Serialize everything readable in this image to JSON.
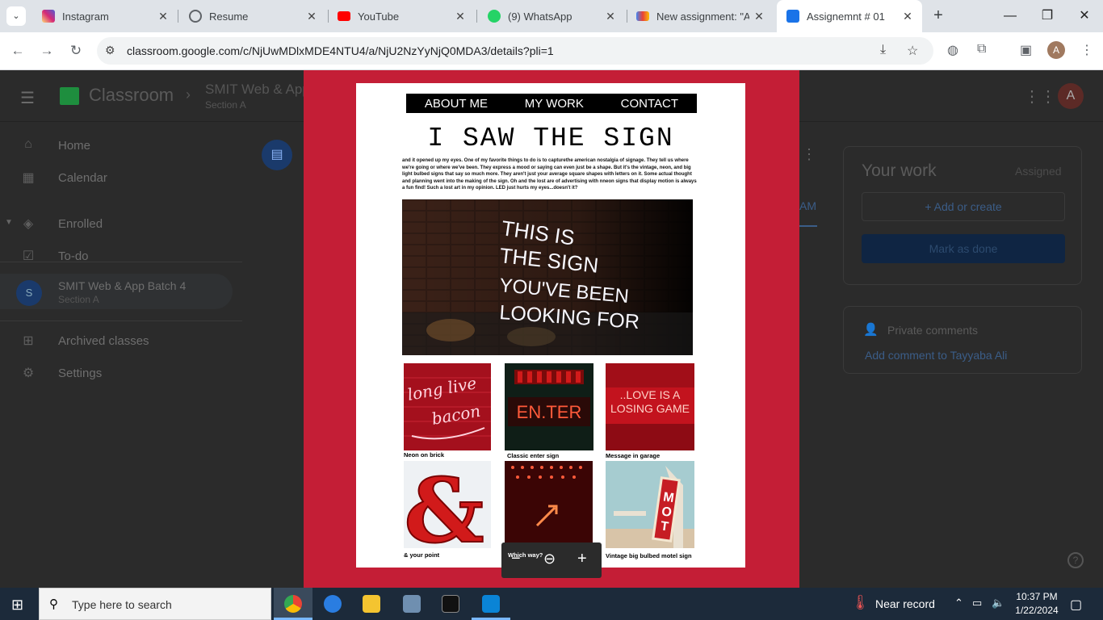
{
  "browser": {
    "tabs": [
      {
        "title": "Instagram",
        "icon": "instagram-icon",
        "color": "#d6249f"
      },
      {
        "title": "Resume",
        "icon": "globe-icon",
        "color": "#5f6368"
      },
      {
        "title": "YouTube",
        "icon": "youtube-icon",
        "color": "#ff0000"
      },
      {
        "title": "(9) WhatsApp",
        "icon": "whatsapp-icon",
        "color": "#25d366"
      },
      {
        "title": "New assignment: \"As",
        "icon": "gmail-icon",
        "color": "#ea4335"
      },
      {
        "title": "Assignemnt # 01",
        "icon": "classroom-icon",
        "color": "#1a73e8"
      }
    ],
    "url": "classroom.google.com/c/NjUwMDlxMDE4NTU4/a/NjU2NzYyNjQ0MDA3/details?pli=1",
    "profile_initial": "A"
  },
  "classroom": {
    "brand": "Classroom",
    "class_name": "SMIT Web & App",
    "section": "Section A",
    "account_initial": "A",
    "nav": [
      {
        "label": "Home",
        "icon": "home-icon"
      },
      {
        "label": "Calendar",
        "icon": "calendar-icon"
      },
      {
        "label": "Enrolled",
        "icon": "enrolled-icon"
      },
      {
        "label": "To-do",
        "icon": "todo-icon"
      },
      {
        "label": "Archived classes",
        "icon": "archive-icon"
      },
      {
        "label": "Settings",
        "icon": "settings-icon"
      }
    ],
    "enrolled_class": {
      "initial": "S",
      "name": "SMIT Web & App Batch 4",
      "section": "Section A"
    },
    "tab_fragment": "AM",
    "your_work": {
      "title": "Your work",
      "status": "Assigned",
      "add_label": "+ Add or create",
      "done_label": "Mark as done"
    },
    "private_comments": {
      "title": "Private comments",
      "link": "Add comment to Tayyaba Ali"
    }
  },
  "document": {
    "nav": [
      "ABOUT ME",
      "MY WORK",
      "CONTACT"
    ],
    "title": "I SAW THE SIGN",
    "paragraph": "and it opened up my eyes. One of my favorite things to do is to capturethe american nostalgia of signage. They tell us where we're going or where we've been. They express a mood or saying can even just be a shape. But it's the vintage, neon, and big light bulbed signs that say so much more. They aren't just your average square shapes with letters on it. Some actual thought and planning went into the making of the sign. Oh and the lost are of advertising with nneon signs that display motion is always a fun find! Such a lost art in my opinion. LED just hurts my eyes...doesn't it?",
    "hero_lines": [
      "THIS IS",
      "THE SIGN",
      "YOU'VE BEEN",
      "LOOKING FOR"
    ],
    "gallery": [
      {
        "caption": "Neon on brick",
        "sign": "long live bacon"
      },
      {
        "caption": "Classic enter sign",
        "sign": "EN.TER"
      },
      {
        "caption": "Message in garage",
        "sign": "LOVE IS A LOSING GAME"
      },
      {
        "caption": "& your point",
        "sign": "&"
      },
      {
        "caption": "Which way?",
        "sign": "arrow"
      },
      {
        "caption": "Vintage big bulbed motel sign",
        "sign": "MOTEL"
      }
    ]
  },
  "taskbar": {
    "search_placeholder": "Type here to search",
    "weather": "Near record",
    "time": "10:37 PM",
    "date": "1/22/2024"
  }
}
